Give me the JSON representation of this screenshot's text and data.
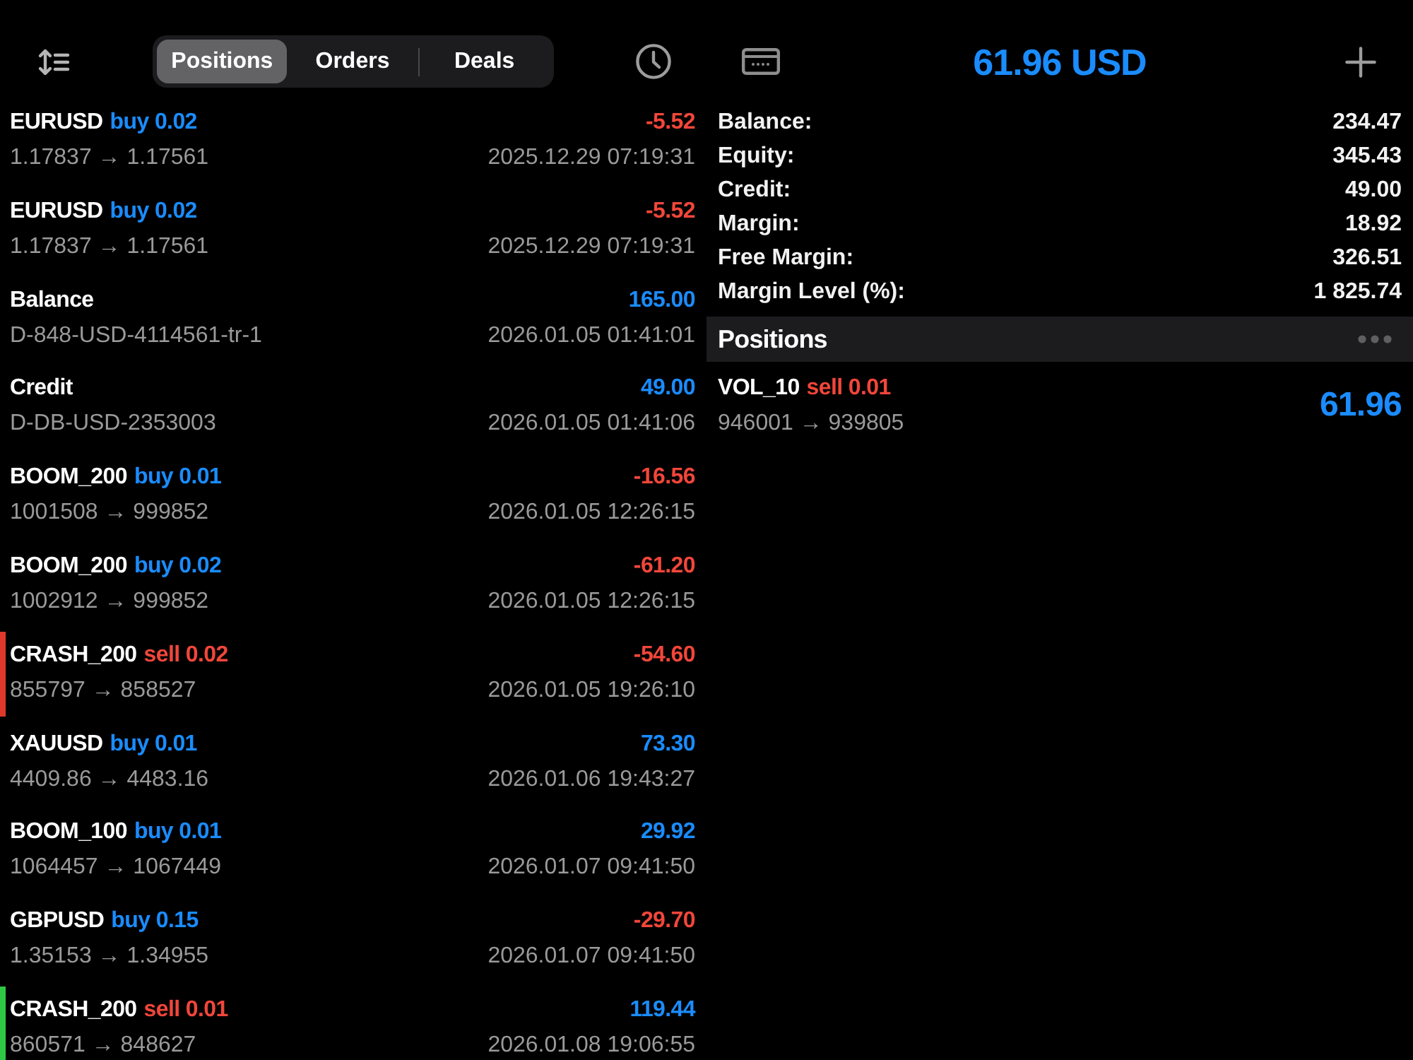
{
  "left_panel": {
    "tabs": [
      {
        "label": "Positions",
        "selected": true
      },
      {
        "label": "Orders",
        "selected": false
      },
      {
        "label": "Deals",
        "selected": false
      }
    ],
    "deals": [
      {
        "symbol": "EURUSD",
        "order": {
          "text": "buy 0.02",
          "color": "#1a8cff"
        },
        "profit": {
          "text": "-5.52",
          "color": "#f2463a"
        },
        "prices": "1.17837 → 1.17561",
        "time": "2025.12.29 07:19:31"
      },
      {
        "symbol": "EURUSD",
        "order": {
          "text": "buy 0.02",
          "color": "#1a8cff"
        },
        "profit": {
          "text": "-5.52",
          "color": "#f2463a"
        },
        "prices": "1.17837 → 1.17561",
        "time": "2025.12.29 07:19:31"
      },
      {
        "symbol": "Balance",
        "profit": {
          "text": "165.00",
          "color": "#1a8cff"
        },
        "prices": "D-848-USD-4114561-tr-1",
        "time": "2026.01.05 01:41:01"
      },
      {
        "symbol": "Credit",
        "profit": {
          "text": "49.00",
          "color": "#1a8cff"
        },
        "prices": "D-DB-USD-2353003",
        "time": "2026.01.05 01:41:06"
      },
      {
        "symbol": "BOOM_200",
        "order": {
          "text": "buy 0.01",
          "color": "#1a8cff"
        },
        "profit": {
          "text": "-16.56",
          "color": "#f2463a"
        },
        "prices": "1001508 → 999852",
        "time": "2026.01.05 12:26:15"
      },
      {
        "symbol": "BOOM_200",
        "order": {
          "text": "buy 0.02",
          "color": "#1a8cff"
        },
        "profit": {
          "text": "-61.20",
          "color": "#f2463a"
        },
        "prices": "1002912 → 999852",
        "time": "2026.01.05 12:26:15"
      },
      {
        "symbol": "CRASH_200",
        "order": {
          "text": "sell 0.02",
          "color": "#f2463a"
        },
        "profit": {
          "text": "-54.60",
          "color": "#f2463a"
        },
        "prices": "855797 → 858527",
        "time": "2026.01.05 19:26:10",
        "marker": {
          "color": "#e0392b"
        }
      },
      {
        "symbol": "XAUUSD",
        "order": {
          "text": "buy 0.01",
          "color": "#1a8cff"
        },
        "profit": {
          "text": "73.30",
          "color": "#1a8cff"
        },
        "prices": "4409.86 → 4483.16",
        "time": "2026.01.06 19:43:27"
      },
      {
        "symbol": "BOOM_100",
        "order": {
          "text": "buy 0.01",
          "color": "#1a8cff"
        },
        "profit": {
          "text": "29.92",
          "color": "#1a8cff"
        },
        "prices": "1064457 → 1067449",
        "time": "2026.01.07 09:41:50"
      },
      {
        "symbol": "GBPUSD",
        "order": {
          "text": "buy 0.15",
          "color": "#1a8cff"
        },
        "profit": {
          "text": "-29.70",
          "color": "#f2463a"
        },
        "prices": "1.35153 → 1.34955",
        "time": "2026.01.07 09:41:50"
      },
      {
        "symbol": "CRASH_200",
        "order": {
          "text": "sell 0.01",
          "color": "#f2463a"
        },
        "profit": {
          "text": "119.44",
          "color": "#1a8cff"
        },
        "prices": "860571 → 848627",
        "time": "2026.01.08 19:06:55",
        "marker": {
          "color": "#2fc845"
        }
      }
    ]
  },
  "right_panel": {
    "title": "61.96 USD",
    "summary": [
      {
        "label": "Balance:",
        "value": "234.47"
      },
      {
        "label": "Equity:",
        "value": "345.43"
      },
      {
        "label": "Credit:",
        "value": "49.00"
      },
      {
        "label": "Margin:",
        "value": "18.92"
      },
      {
        "label": "Free Margin:",
        "value": "326.51"
      },
      {
        "label": "Margin Level (%):",
        "value": "1 825.74"
      }
    ],
    "section": {
      "title": "Positions"
    },
    "positions": [
      {
        "symbol": "VOL_10",
        "order": {
          "text": "sell 0.01",
          "color": "#f2463a"
        },
        "profit": {
          "text": "61.96",
          "color": "#1a8cff"
        },
        "prices": "946001 → 939805"
      }
    ]
  }
}
